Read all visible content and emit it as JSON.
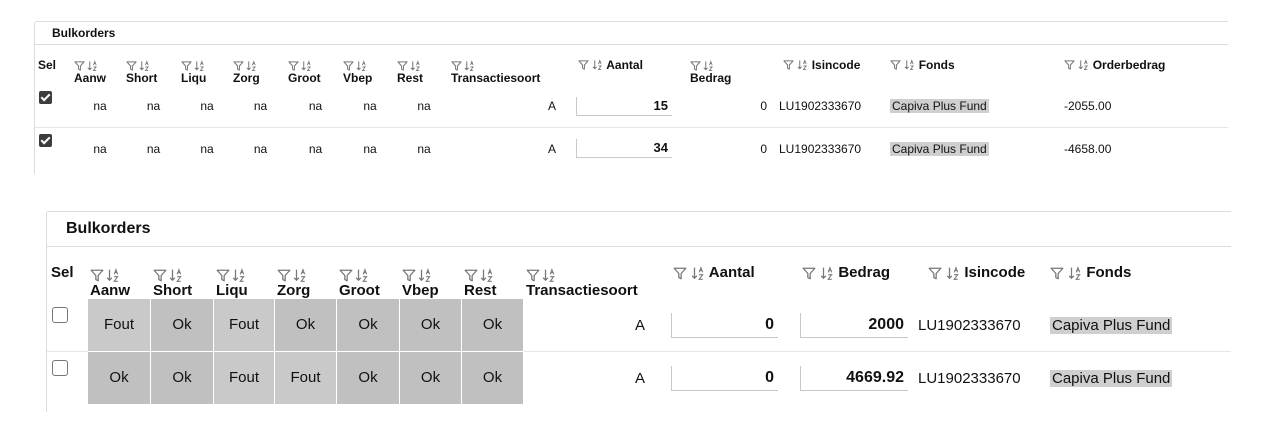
{
  "panel1": {
    "title": "Bulkorders",
    "columns": {
      "sel": "Sel",
      "aanw": "Aanw",
      "short": "Short",
      "liqu": "Liqu",
      "zorg": "Zorg",
      "groot": "Groot",
      "vbep": "Vbep",
      "rest": "Rest",
      "transactiesoort": "Transactiesoort",
      "aantal": "Aantal",
      "bedrag": "Bedrag",
      "isincode": "Isincode",
      "fonds": "Fonds",
      "orderbedrag": "Orderbedrag"
    },
    "rows": [
      {
        "selected": true,
        "aanw": "na",
        "short": "na",
        "liqu": "na",
        "zorg": "na",
        "groot": "na",
        "vbep": "na",
        "rest": "na",
        "transactiesoort": "A",
        "aantal": "15",
        "bedrag": "0",
        "isincode": "LU1902333670",
        "fonds": "Capiva Plus Fund",
        "orderbedrag": "-2055.00"
      },
      {
        "selected": true,
        "aanw": "na",
        "short": "na",
        "liqu": "na",
        "zorg": "na",
        "groot": "na",
        "vbep": "na",
        "rest": "na",
        "transactiesoort": "A",
        "aantal": "34",
        "bedrag": "0",
        "isincode": "LU1902333670",
        "fonds": "Capiva Plus Fund",
        "orderbedrag": "-4658.00"
      }
    ]
  },
  "panel2": {
    "title": "Bulkorders",
    "columns": {
      "sel": "Sel",
      "aanw": "Aanw",
      "short": "Short",
      "liqu": "Liqu",
      "zorg": "Zorg",
      "groot": "Groot",
      "vbep": "Vbep",
      "rest": "Rest",
      "transactiesoort": "Transactiesoort",
      "aantal": "Aantal",
      "bedrag": "Bedrag",
      "isincode": "Isincode",
      "fonds": "Fonds"
    },
    "rows": [
      {
        "selected": false,
        "aanw": "Fout",
        "short": "Ok",
        "liqu": "Fout",
        "zorg": "Ok",
        "groot": "Ok",
        "vbep": "Ok",
        "rest": "Ok",
        "transactiesoort": "A",
        "aantal": "0",
        "bedrag": "2000",
        "isincode": "LU1902333670",
        "fonds": "Capiva Plus Fund"
      },
      {
        "selected": false,
        "aanw": "Ok",
        "short": "Ok",
        "liqu": "Fout",
        "zorg": "Fout",
        "groot": "Ok",
        "vbep": "Ok",
        "rest": "Ok",
        "transactiesoort": "A",
        "aantal": "0",
        "bedrag": "4669.92",
        "isincode": "LU1902333670",
        "fonds": "Capiva Plus Fund"
      }
    ]
  },
  "icons": {
    "filter": "filter-icon",
    "sort": "sort-icon"
  },
  "colors": {
    "status_fout": "#c9c9c9",
    "status_ok": "#c0c0c0",
    "fonds_highlight": "#cfcfcf",
    "border": "#dcdcdc"
  }
}
